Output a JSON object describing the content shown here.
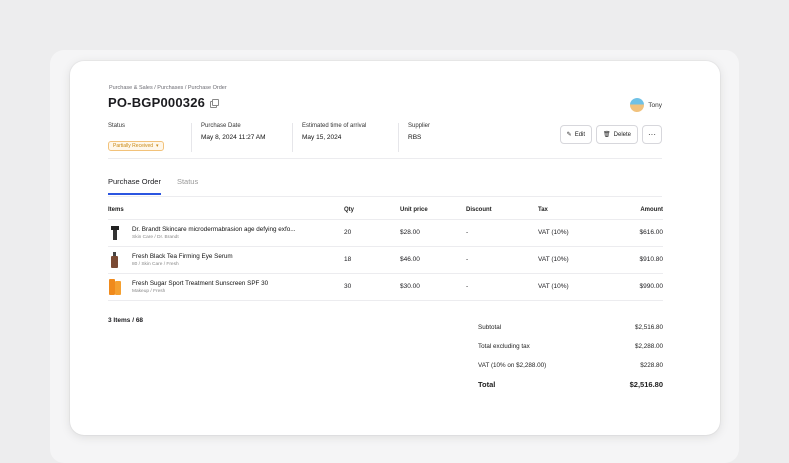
{
  "breadcrumb": "Purchase & Sales / Purchases / Purchase Order",
  "title": "PO-BGP000326",
  "user": {
    "name": "Tony"
  },
  "meta": {
    "status_label": "Status",
    "status_value": "Partially Received",
    "purchase_date_label": "Purchase Date",
    "purchase_date_value": "May 8, 2024 11:27 AM",
    "eta_label": "Estimated time of arrival",
    "eta_value": "May 15, 2024",
    "supplier_label": "Supplier",
    "supplier_value": "RBS"
  },
  "actions": {
    "edit": "Edit",
    "delete": "Delete",
    "more": "···"
  },
  "tabs": [
    "Purchase Order",
    "Status"
  ],
  "table": {
    "headers": [
      "Items",
      "Qty",
      "Unit price",
      "Discount",
      "Tax",
      "Amount"
    ],
    "rows": [
      {
        "name": "Dr. Brandt Skincare microdermabrasion age defying exfo...",
        "sub": "Skin Care / Dr. Brandt",
        "qty": "20",
        "unit_price": "$28.00",
        "discount": "-",
        "tax": "VAT (10%)",
        "amount": "$616.00"
      },
      {
        "name": "Fresh Black Tea Firming Eye Serum",
        "sub": "80 / Skin Care / Fresh",
        "qty": "18",
        "unit_price": "$46.00",
        "discount": "-",
        "tax": "VAT (10%)",
        "amount": "$910.80"
      },
      {
        "name": "Fresh Sugar Sport Treatment Sunscreen SPF 30",
        "sub": "Makeup / Fresh",
        "qty": "30",
        "unit_price": "$30.00",
        "discount": "-",
        "tax": "VAT (10%)",
        "amount": "$990.00"
      }
    ]
  },
  "summary": {
    "count": "3 Items / 68"
  },
  "totals": {
    "subtotal_label": "Subtotal",
    "subtotal_value": "$2,516.80",
    "excl_label": "Total excluding tax",
    "excl_value": "$2,288.00",
    "vat_label": "VAT (10% on $2,288.00)",
    "vat_value": "$228.80",
    "total_label": "Total",
    "total_value": "$2,516.80"
  },
  "colors": {
    "accent": "#2b55e0",
    "status": "#c98a16"
  }
}
